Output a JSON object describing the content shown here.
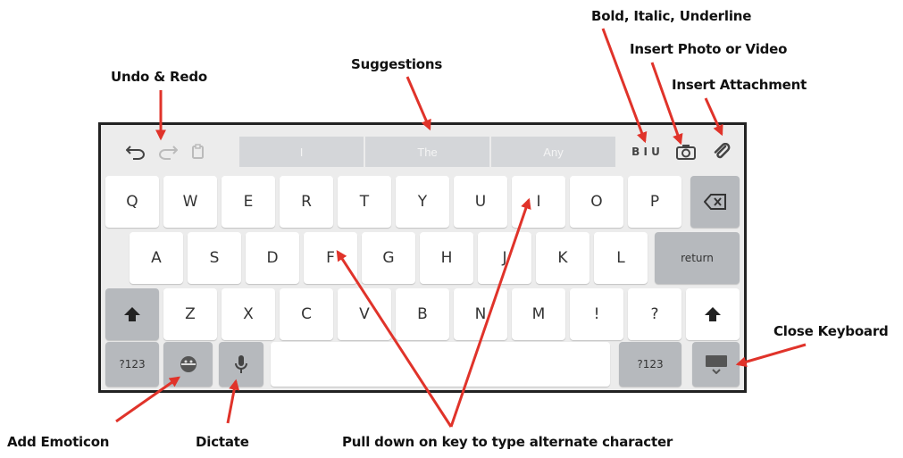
{
  "annotations": {
    "undo_redo": "Undo & Redo",
    "suggestions": "Suggestions",
    "bold_italic_underline": "Bold, Italic, Underline",
    "insert_photo_video": "Insert Photo or Video",
    "insert_attachment": "Insert Attachment",
    "close_keyboard": "Close Keyboard",
    "add_emoticon": "Add Emoticon",
    "dictate": "Dictate",
    "pull_down": "Pull down on key to type alternate character"
  },
  "toolbar": {
    "suggestions": [
      "I",
      "The",
      "Any"
    ],
    "biu_label": "B I U"
  },
  "rows": {
    "row1": [
      "Q",
      "W",
      "E",
      "R",
      "T",
      "Y",
      "U",
      "I",
      "O",
      "P"
    ],
    "row2": [
      "A",
      "S",
      "D",
      "F",
      "G",
      "H",
      "J",
      "K",
      "L"
    ],
    "row3": [
      "Z",
      "X",
      "C",
      "V",
      "B",
      "N",
      "M",
      "!",
      "?"
    ]
  },
  "keys": {
    "return_label": "return",
    "numbers_label": "?123"
  },
  "colors": {
    "arrow": "#e0332a",
    "function_key": "#b6b9bd",
    "keyboard_bg": "#ececec"
  },
  "icons": [
    "undo-icon",
    "redo-icon",
    "paste-icon",
    "camera-icon",
    "paperclip-icon",
    "backspace-icon",
    "shift-icon",
    "emoji-icon",
    "microphone-icon",
    "keyboard-hide-icon"
  ]
}
